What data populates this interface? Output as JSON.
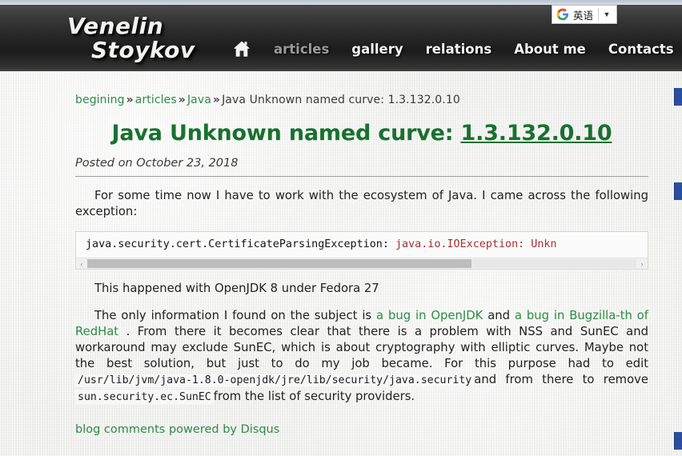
{
  "site": {
    "logo_line1": "Venelin",
    "logo_line2": "Stoykov",
    "home_icon": "home-icon"
  },
  "nav": {
    "items": [
      {
        "label": "articles",
        "state": "dim"
      },
      {
        "label": "gallery",
        "state": "normal"
      },
      {
        "label": "relations",
        "state": "normal"
      },
      {
        "label": "About me",
        "state": "normal"
      },
      {
        "label": "Contacts",
        "state": "normal"
      }
    ]
  },
  "translate_widget": {
    "icon": "google-g-icon",
    "language": "英语",
    "caret": "▼"
  },
  "breadcrumb": {
    "item1": "begining",
    "sep1": "»",
    "item2": "articles",
    "sep2": "»",
    "item3": "Java",
    "sep3": "»",
    "current": "Java Unknown named curve: 1.3.132.0.10"
  },
  "article": {
    "title_prefix": "Java Unknown named curve: ",
    "title_link": "1.3.132.0.10",
    "posted": "Posted on October 23, 2018",
    "para1": "For some time now I have to work with the ecosystem of Java. I came across the following exception:",
    "code_black": "java.security.cert.CertificateParsingException: ",
    "code_red": "java.io.IOException: Unkn",
    "para2": "This happened with OpenJDK 8 under Fedora 27",
    "para3_a": "The only information I found on the subject is ",
    "para3_link1": "a bug in OpenJDK",
    "para3_b": " and ",
    "para3_link2": "a bug in Bugzilla-th of RedHat",
    "para3_c": " . From there it becomes clear that there is a problem with NSS and SunEC and workaround may exclude SunEC, which is about cryptography with elliptic curves. Maybe not the best solution, but just to do my job became. For this purpose had to edit ",
    "para3_code1": "/usr/lib/jvm/java-1.8.0-openjdk/jre/lib/security/java.security",
    "para3_d": "and from there to remove ",
    "para3_code2": "sun.security.ec.SunEC",
    "para3_e": "from the list of security providers."
  },
  "footer": {
    "disqus": "blog comments powered by Disqus"
  },
  "scrollbar": {
    "left_arrow": "‹",
    "right_arrow": "›"
  },
  "colors": {
    "link_green": "#2e8b45",
    "title_green": "#18712f",
    "code_red": "#a23131",
    "header_dark": "#2a2a2a",
    "share_blue": "#2b4f9e"
  }
}
